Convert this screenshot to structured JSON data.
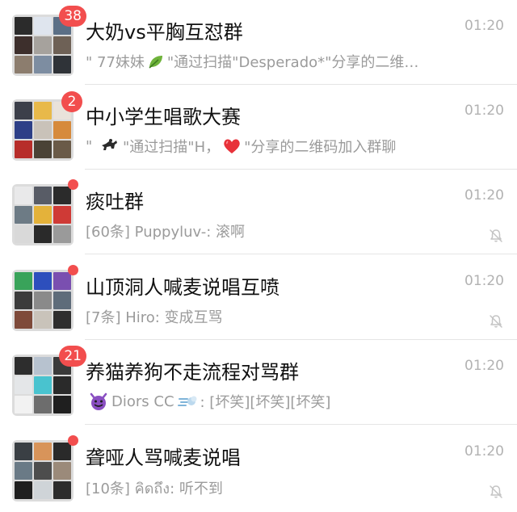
{
  "chats": [
    {
      "name": "大奶vs平胸互怼群",
      "time": "01:20",
      "badge": "38",
      "preview": [
        "\" 77妹妹",
        {
          "icon": "leaf-emoji"
        },
        "\"通过扫描\"Desperado*\"分享的二维…"
      ],
      "muted": false,
      "avatar_colors": [
        "#2b2b2b",
        "#dfe5ee",
        "#5b6f86",
        "#3d2f2c",
        "#a6a29d",
        "#6e6156",
        "#8c7d6e",
        "#7d8da1",
        "#2f3338"
      ]
    },
    {
      "name": "中小学生唱歌大赛",
      "time": "01:20",
      "badge": "2",
      "preview": [
        "\" ",
        {
          "icon": "horse-rider-emoji"
        },
        "\"通过扫描\"H，",
        {
          "icon": "red-heart-emoji"
        },
        "\"分享的二维码加入群聊"
      ],
      "muted": false,
      "avatar_colors": [
        "#3c3f4a",
        "#e8b94a",
        "#e9e2da",
        "#2d3f87",
        "#c9c2b9",
        "#d68a3c",
        "#b72d2a",
        "#4a4236",
        "#6a5a48"
      ]
    },
    {
      "name": "痰吐群",
      "time": "01:20",
      "badge": "",
      "preview": [
        "[60条] Puppyluv-: 滚啊"
      ],
      "muted": true,
      "avatar_colors": [
        "#e9e9ea",
        "#585c66",
        "#2b2b2b",
        "#6d7b85",
        "#e4b23a",
        "#cf3a36",
        "#d9d9d9",
        "#2a2a2a",
        "#9a9a9a"
      ]
    },
    {
      "name": "山顶洞人喊麦说唱互喷",
      "time": "01:20",
      "badge": "",
      "preview": [
        "[7条] Hiro: 变成互骂"
      ],
      "muted": true,
      "avatar_colors": [
        "#39a35a",
        "#2d4fbd",
        "#7a4fb0",
        "#3b3b3b",
        "#8a8a8a",
        "#5e6c7a",
        "#7e4a3a",
        "#c9c3ba",
        "#2e2e2e"
      ]
    },
    {
      "name": "养猫养狗不走流程对骂群",
      "time": "01:20",
      "badge": "21",
      "preview": [
        {
          "icon": "smiling-devil-emoji"
        },
        "Diors CC",
        {
          "icon": "dash-emoji"
        },
        ": [坏笑][坏笑][坏笑]"
      ],
      "muted": false,
      "avatar_colors": [
        "#2d2d2d",
        "#b7c2cf",
        "#3a3a3a",
        "#e4e6e8",
        "#49c3cf",
        "#2a2a2a",
        "#f2f2f2",
        "#6d6d6d",
        "#1f1f1f"
      ]
    },
    {
      "name": "聋哑人骂喊麦说唱",
      "time": "01:20",
      "badge": "",
      "preview": [
        "[10条] คิดถึง: 听不到"
      ],
      "muted": true,
      "avatar_colors": [
        "#3a3f44",
        "#d8945a",
        "#2a2a2a",
        "#6a7a86",
        "#4d4d4d",
        "#9b8a7a",
        "#1f1f1f",
        "#cfd4d8",
        "#2c2c2c"
      ]
    }
  ]
}
